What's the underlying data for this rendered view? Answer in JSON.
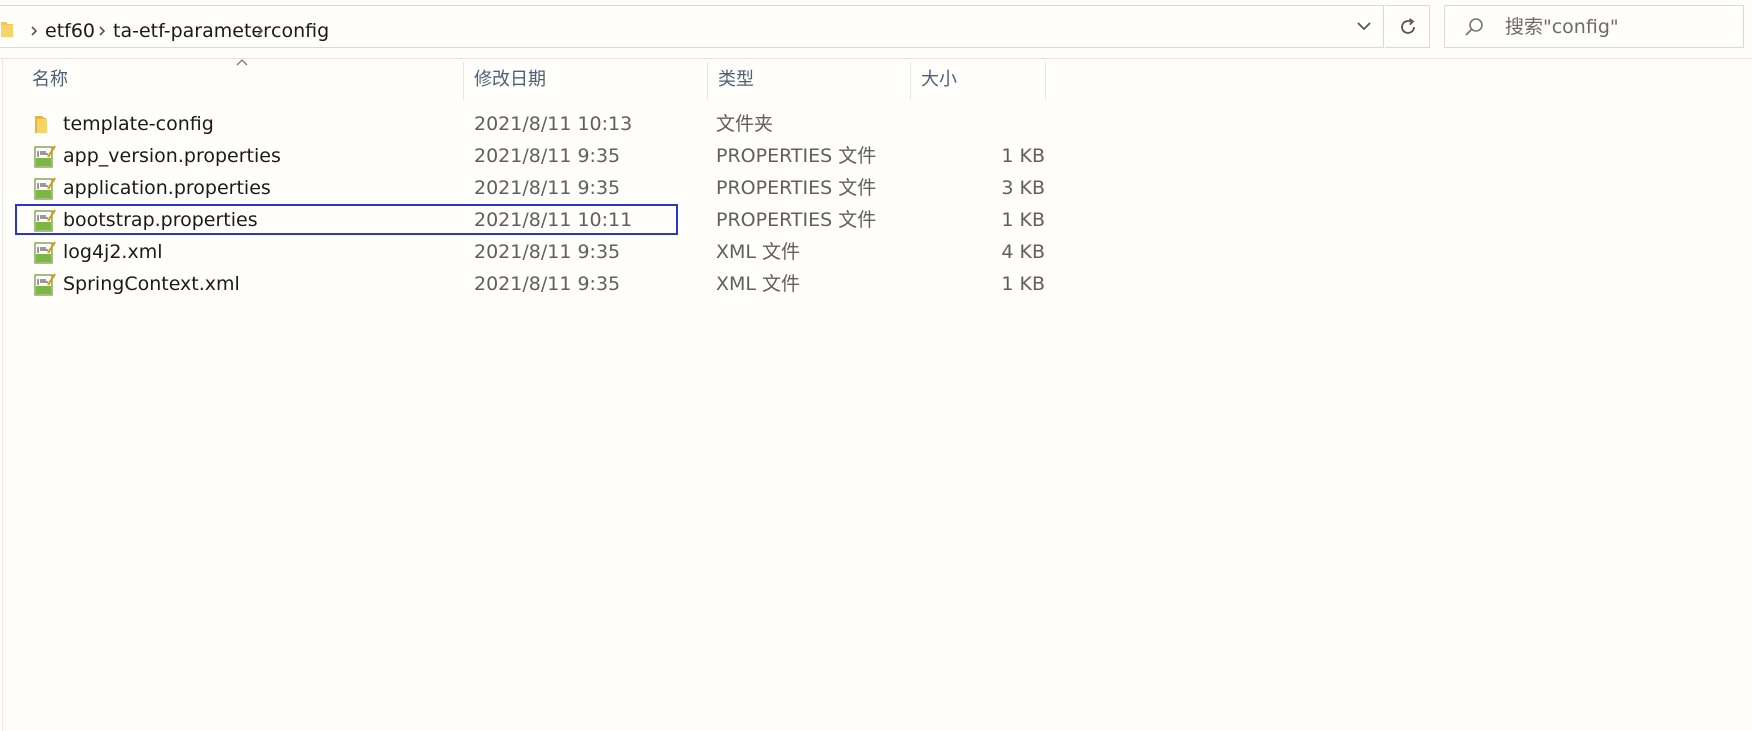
{
  "breadcrumb": {
    "items": [
      "etf60",
      "ta-etf-parameter",
      "config"
    ]
  },
  "search": {
    "placeholder": "搜索\"config\""
  },
  "columns": {
    "name": "名称",
    "modified": "修改日期",
    "type": "类型",
    "size": "大小"
  },
  "files": [
    {
      "name": "template-config",
      "modified": "2021/8/11 10:13",
      "type": "文件夹",
      "size": "",
      "icon": "folder-icon"
    },
    {
      "name": "app_version.properties",
      "modified": "2021/8/11 9:35",
      "type": "PROPERTIES 文件",
      "size": "1 KB",
      "icon": "properties-file-icon"
    },
    {
      "name": "application.properties",
      "modified": "2021/8/11 9:35",
      "type": "PROPERTIES 文件",
      "size": "3 KB",
      "icon": "properties-file-icon"
    },
    {
      "name": "bootstrap.properties",
      "modified": "2021/8/11 10:11",
      "type": "PROPERTIES 文件",
      "size": "1 KB",
      "icon": "properties-file-icon",
      "selected": true
    },
    {
      "name": "log4j2.xml",
      "modified": "2021/8/11 9:35",
      "type": "XML 文件",
      "size": "4 KB",
      "icon": "xml-file-icon"
    },
    {
      "name": "SpringContext.xml",
      "modified": "2021/8/11 9:35",
      "type": "XML 文件",
      "size": "1 KB",
      "icon": "xml-file-icon"
    }
  ],
  "colors": {
    "selection_outline": "#2b37c9",
    "header_text": "#4c607a",
    "folder_yellow": "#f3c74f"
  }
}
